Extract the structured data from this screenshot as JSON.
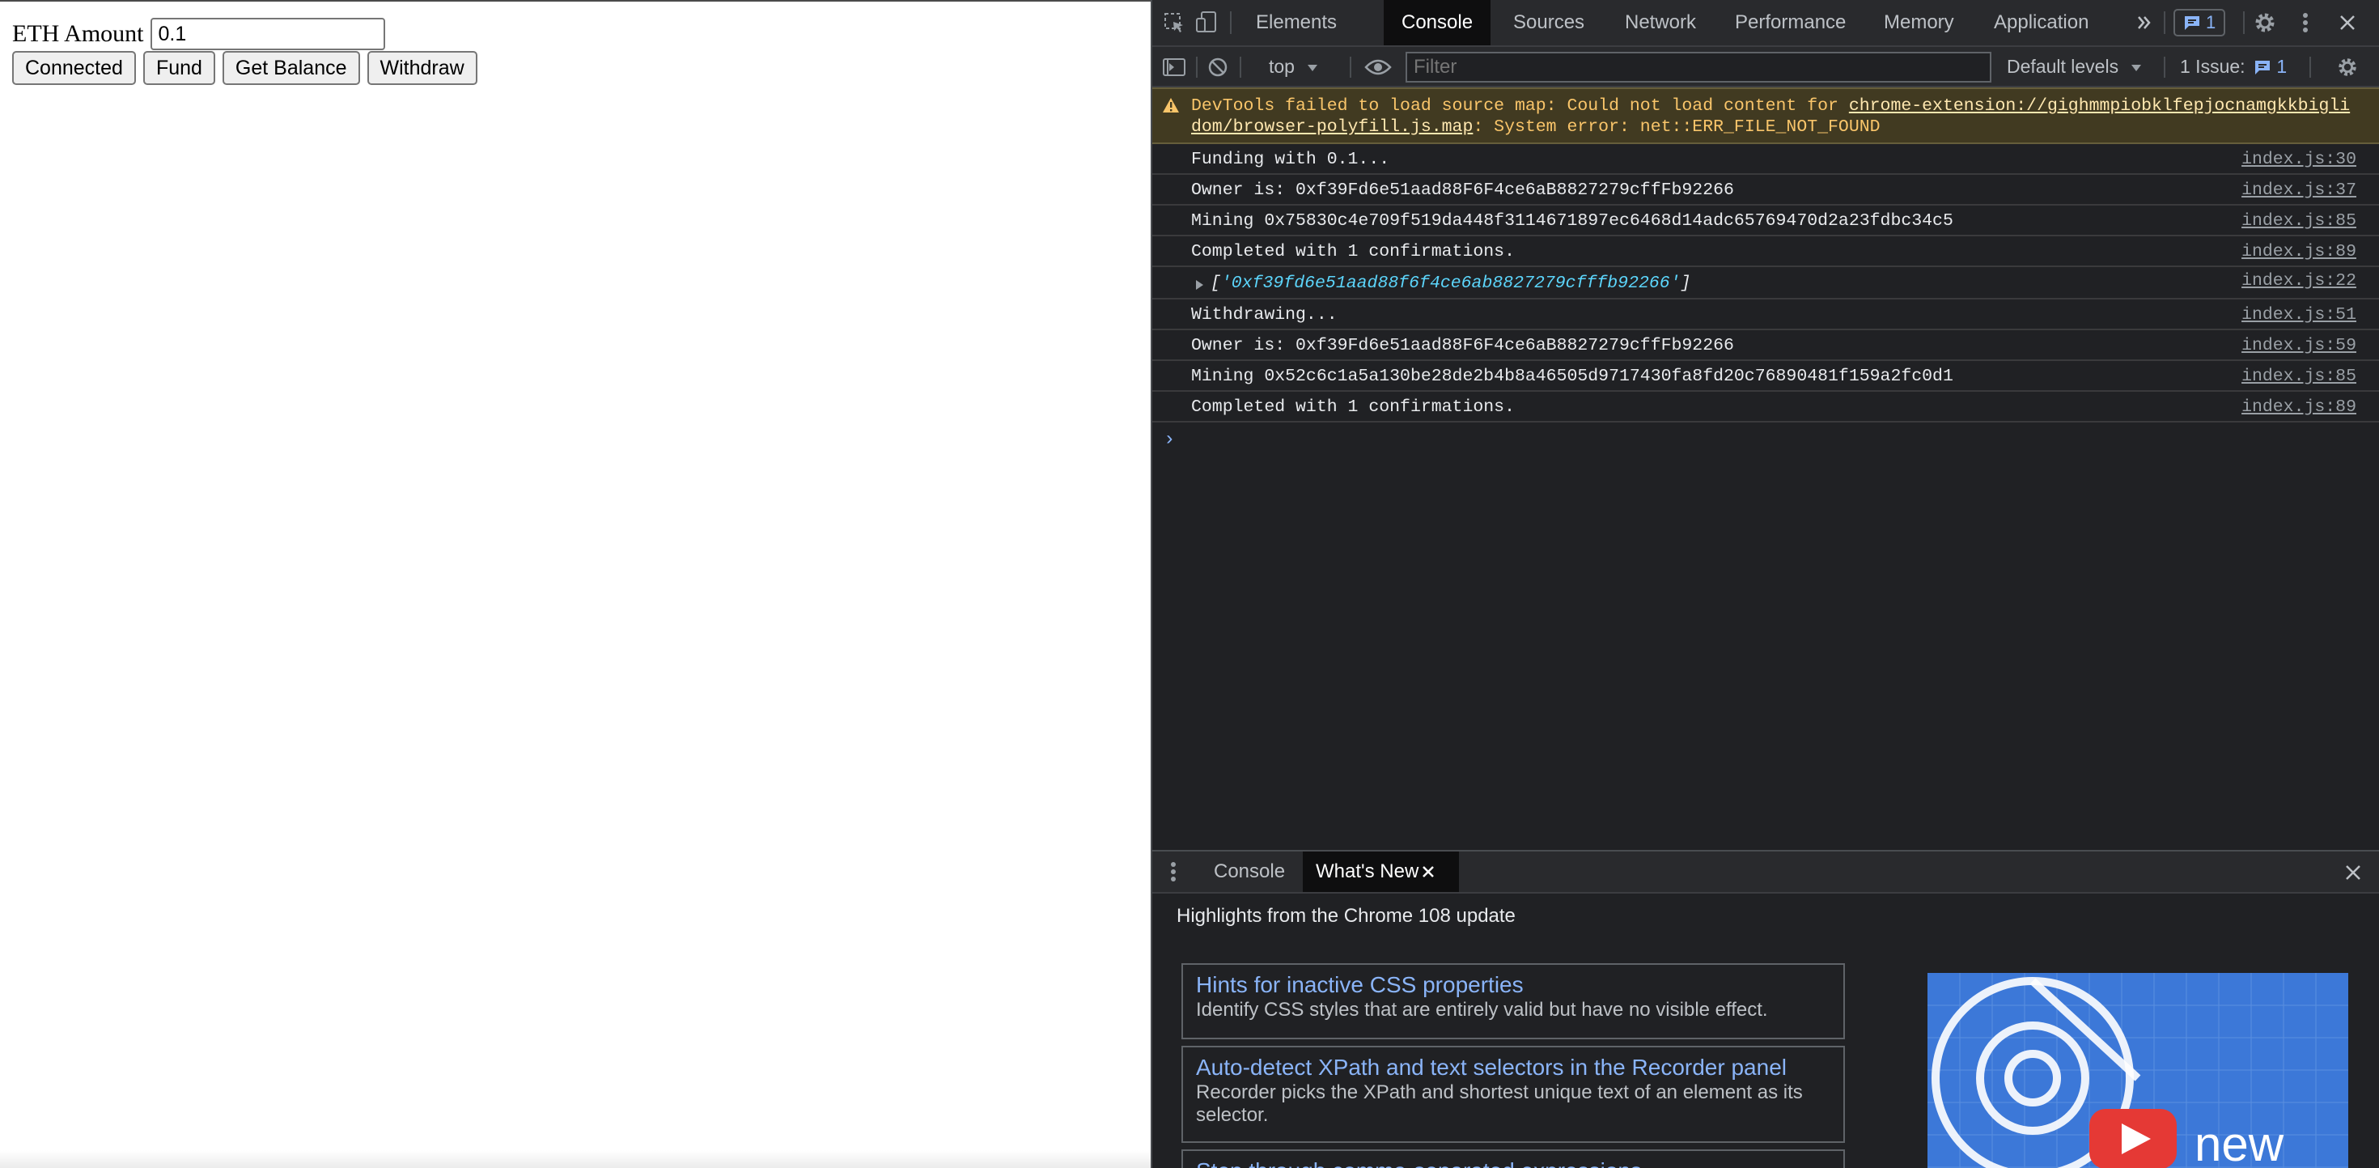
{
  "page": {
    "eth_label": "ETH Amount",
    "eth_value": "0.1",
    "buttons": [
      "Connected",
      "Fund",
      "Get Balance",
      "Withdraw"
    ]
  },
  "devtools": {
    "tabs": [
      "Elements",
      "Console",
      "Sources",
      "Network",
      "Performance",
      "Memory",
      "Application"
    ],
    "active_tab": "Console",
    "more_tabs_icon": "double-chevron-icon",
    "message_badge_count": "1",
    "toolbar": {
      "context": "top",
      "filter_placeholder": "Filter",
      "levels": "Default levels",
      "issues_label": "1 Issue:",
      "issues_count": "1"
    },
    "warning": {
      "prefix": "DevTools failed to load source map: Could not load content for ",
      "link": "chrome-extension://gighmmpiobklfepjocnamgkkbiglidom/browser-polyfill.js.map",
      "suffix": ": System error: net::ERR_FILE_NOT_FOUND"
    },
    "messages": [
      {
        "text": "Funding with 0.1...",
        "source": "index.js:30"
      },
      {
        "text": "Owner is: 0xf39Fd6e51aad88F6F4ce6aB8827279cffFb92266",
        "source": "index.js:37"
      },
      {
        "text": "Mining 0x75830c4e709f519da448f3114671897ec6468d14adc65769470d2a23fdbc34c5",
        "source": "index.js:85"
      },
      {
        "text": "Completed with 1 confirmations.",
        "source": "index.js:89"
      }
    ],
    "array_message": {
      "open": "[",
      "value": "'0xf39fd6e51aad88f6f4ce6ab8827279cfffb92266'",
      "close": "]",
      "source": "index.js:22"
    },
    "messages2": [
      {
        "text": "Withdrawing...",
        "source": "index.js:51"
      },
      {
        "text": "Owner is: 0xf39Fd6e51aad88F6F4ce6aB8827279cffFb92266",
        "source": "index.js:59"
      },
      {
        "text": "Mining 0x52c6c1a5a130be28de2b4b8a46505d9717430fa8fd20c76890481f159a2fc0d1",
        "source": "index.js:85"
      },
      {
        "text": "Completed with 1 confirmations.",
        "source": "index.js:89"
      }
    ],
    "prompt": "›",
    "drawer": {
      "tabs": [
        "Console",
        "What's New"
      ],
      "active_tab": "What's New",
      "title": "Highlights from the Chrome 108 update",
      "cards": [
        {
          "title": "Hints for inactive CSS properties",
          "desc": "Identify CSS styles that are entirely valid but have no visible effect."
        },
        {
          "title": "Auto-detect XPath and text selectors in the Recorder panel",
          "desc": "Recorder picks the XPath and shortest unique text of an element as its selector."
        },
        {
          "title": "Step through comma-separated expressions",
          "desc": ""
        }
      ],
      "video_label": "new"
    },
    "colors": {
      "warning_bg": "#413a21",
      "warning_text": "#f9c56a",
      "accent": "#8ab4f8",
      "panel_bg": "#202124"
    }
  }
}
